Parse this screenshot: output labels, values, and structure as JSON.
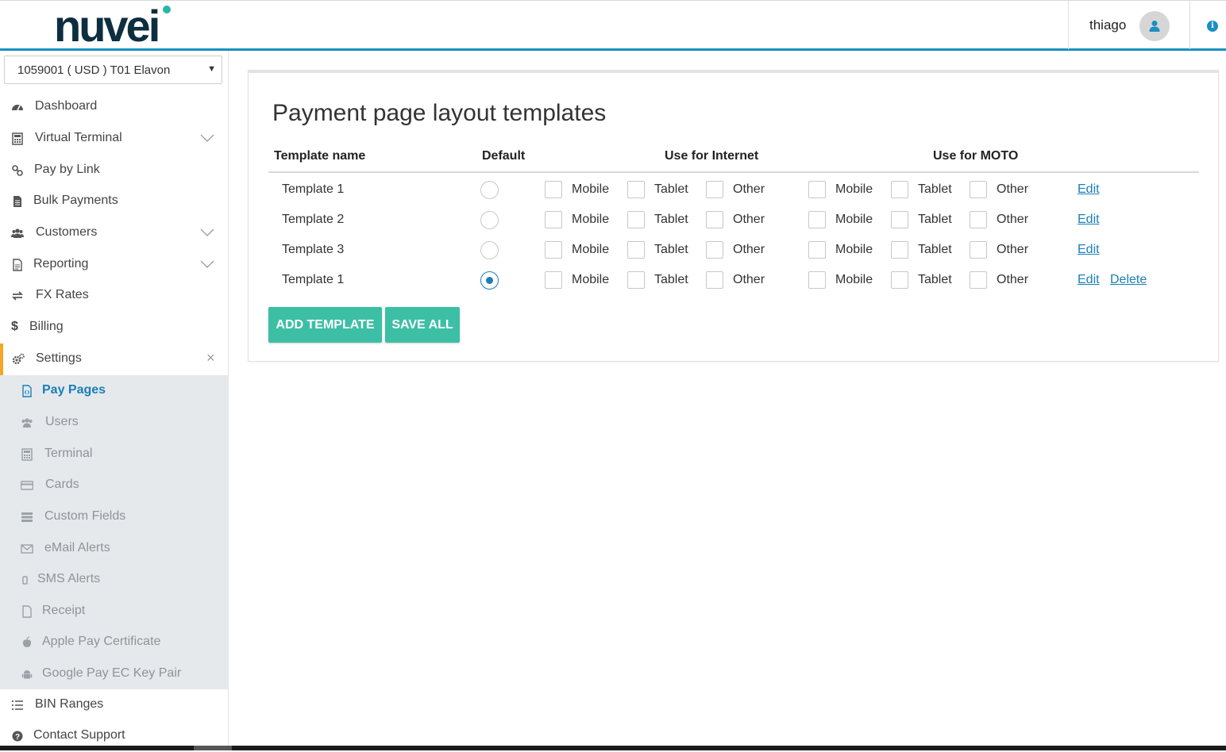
{
  "header": {
    "logo_text": "nuvei",
    "user_name": "thiago",
    "info_icon": "i"
  },
  "sidebar": {
    "merchant_select": "1059001 ( USD ) T01 Elavon",
    "items": [
      {
        "label": "Dashboard",
        "icon": "dashboard-icon"
      },
      {
        "label": "Virtual Terminal",
        "icon": "calculator-icon",
        "expandable": true
      },
      {
        "label": "Pay by Link",
        "icon": "link-icon"
      },
      {
        "label": "Bulk Payments",
        "icon": "file-icon"
      },
      {
        "label": "Customers",
        "icon": "users-icon",
        "expandable": true
      },
      {
        "label": "Reporting",
        "icon": "report-icon",
        "expandable": true
      },
      {
        "label": "FX Rates",
        "icon": "exchange-icon"
      },
      {
        "label": "Billing",
        "icon": "dollar-icon"
      },
      {
        "label": "Settings",
        "icon": "gears-icon",
        "expanded": true
      }
    ],
    "settings_items": [
      {
        "label": "Pay Pages",
        "icon": "code-file-icon",
        "current": true
      },
      {
        "label": "Users",
        "icon": "users-icon"
      },
      {
        "label": "Terminal",
        "icon": "calculator-icon"
      },
      {
        "label": "Cards",
        "icon": "credit-card-icon"
      },
      {
        "label": "Custom Fields",
        "icon": "tasks-icon"
      },
      {
        "label": "eMail Alerts",
        "icon": "envelope-icon"
      },
      {
        "label": "SMS Alerts",
        "icon": "mobile-icon"
      },
      {
        "label": "Receipt",
        "icon": "file-icon"
      },
      {
        "label": "Apple Pay Certificate",
        "icon": "apple-icon"
      },
      {
        "label": "Google Pay EC Key Pair",
        "icon": "android-icon"
      }
    ],
    "bottom_items": [
      {
        "label": "BIN Ranges",
        "icon": "list-icon"
      },
      {
        "label": "Contact Support",
        "icon": "question-circle-icon"
      }
    ]
  },
  "main": {
    "title": "Payment page layout templates",
    "columns": {
      "template_name": "Template name",
      "default": "Default",
      "internet": "Use for Internet",
      "moto": "Use for MOTO"
    },
    "device_labels": [
      "Mobile",
      "Tablet",
      "Other"
    ],
    "rows": [
      {
        "name": "Template 1",
        "default": false,
        "edit": "Edit",
        "delete": ""
      },
      {
        "name": "Template 2",
        "default": false,
        "edit": "Edit",
        "delete": ""
      },
      {
        "name": "Template 3",
        "default": false,
        "edit": "Edit",
        "delete": ""
      },
      {
        "name": "Template 1",
        "default": true,
        "edit": "Edit",
        "delete": "Delete"
      }
    ],
    "buttons": {
      "add": "ADD TEMPLATE",
      "save": "SAVE ALL"
    }
  },
  "colors": {
    "accent": "#1a8fc2",
    "button": "#3dbfa6",
    "active_marker": "#f5a623",
    "submenu_bg": "#e6e9ec"
  }
}
